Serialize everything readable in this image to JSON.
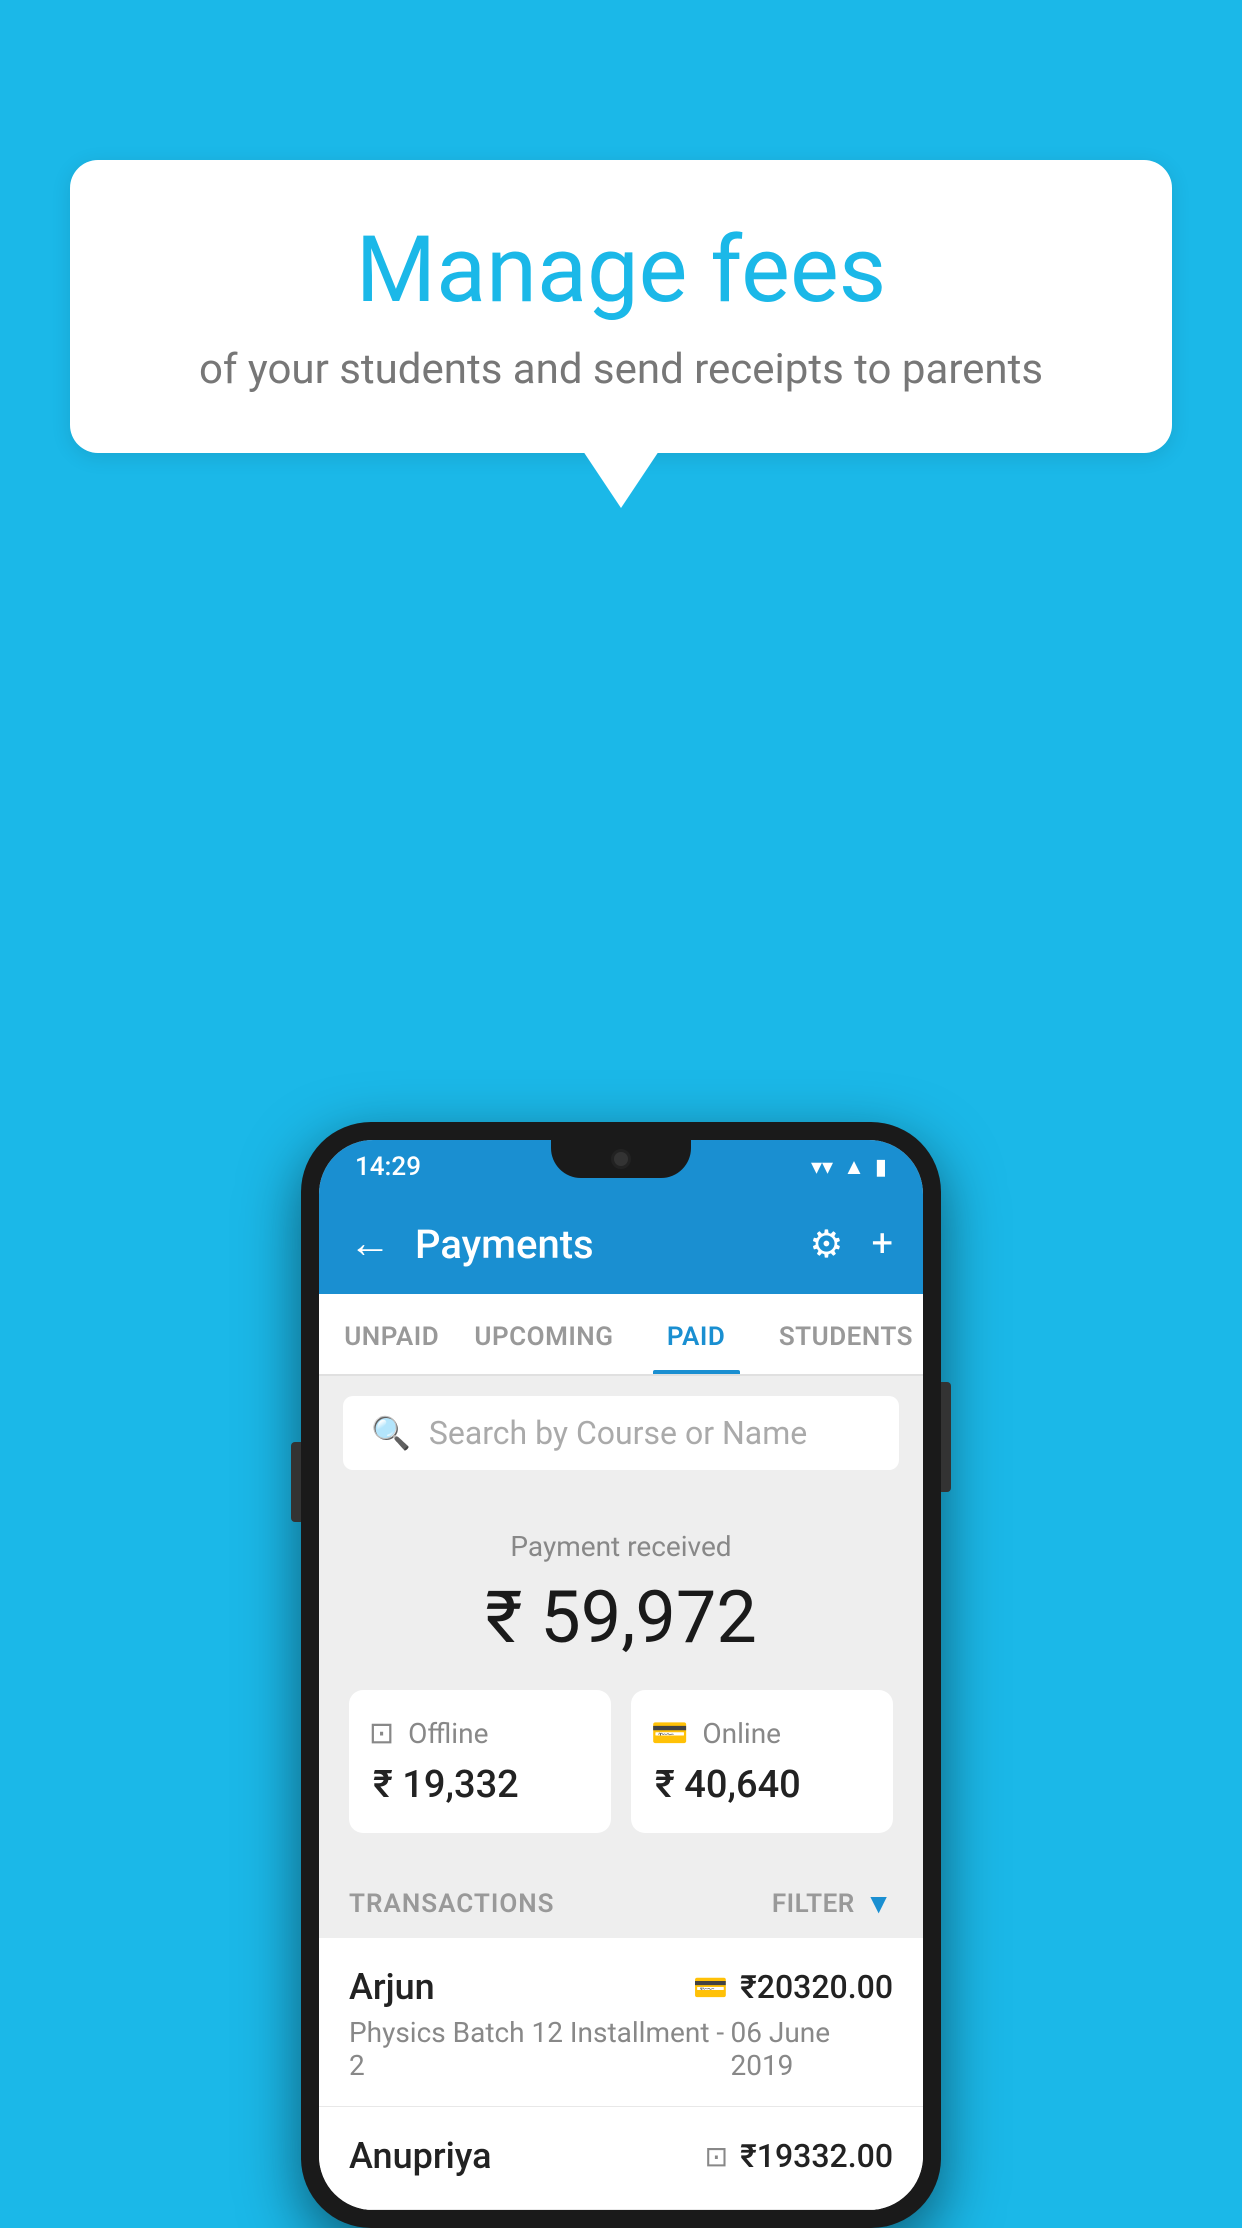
{
  "hero": {
    "title": "Manage fees",
    "subtitle": "of your students and send receipts to parents"
  },
  "status_bar": {
    "time": "14:29",
    "icons": [
      "wifi",
      "signal",
      "battery"
    ]
  },
  "app_bar": {
    "title": "Payments",
    "back_label": "←",
    "settings_label": "⚙",
    "add_label": "+"
  },
  "tabs": [
    {
      "label": "UNPAID",
      "active": false
    },
    {
      "label": "UPCOMING",
      "active": false
    },
    {
      "label": "PAID",
      "active": true
    },
    {
      "label": "STUDENTS",
      "active": false
    }
  ],
  "search": {
    "placeholder": "Search by Course or Name"
  },
  "payment_summary": {
    "label": "Payment received",
    "total_amount": "₹ 59,972",
    "offline_label": "Offline",
    "offline_amount": "₹ 19,332",
    "online_label": "Online",
    "online_amount": "₹ 40,640"
  },
  "transactions": {
    "header_label": "TRANSACTIONS",
    "filter_label": "FILTER",
    "rows": [
      {
        "name": "Arjun",
        "course": "Physics Batch 12 Installment - 2",
        "amount": "₹20320.00",
        "date": "06 June 2019",
        "payment_type": "card"
      },
      {
        "name": "Anupriya",
        "course": "",
        "amount": "₹19332.00",
        "date": "",
        "payment_type": "offline"
      }
    ]
  },
  "colors": {
    "background": "#1bb8e8",
    "app_bar": "#1a8fd1",
    "active_tab": "#1a8fd1",
    "filter_icon": "#1a8fd1"
  }
}
